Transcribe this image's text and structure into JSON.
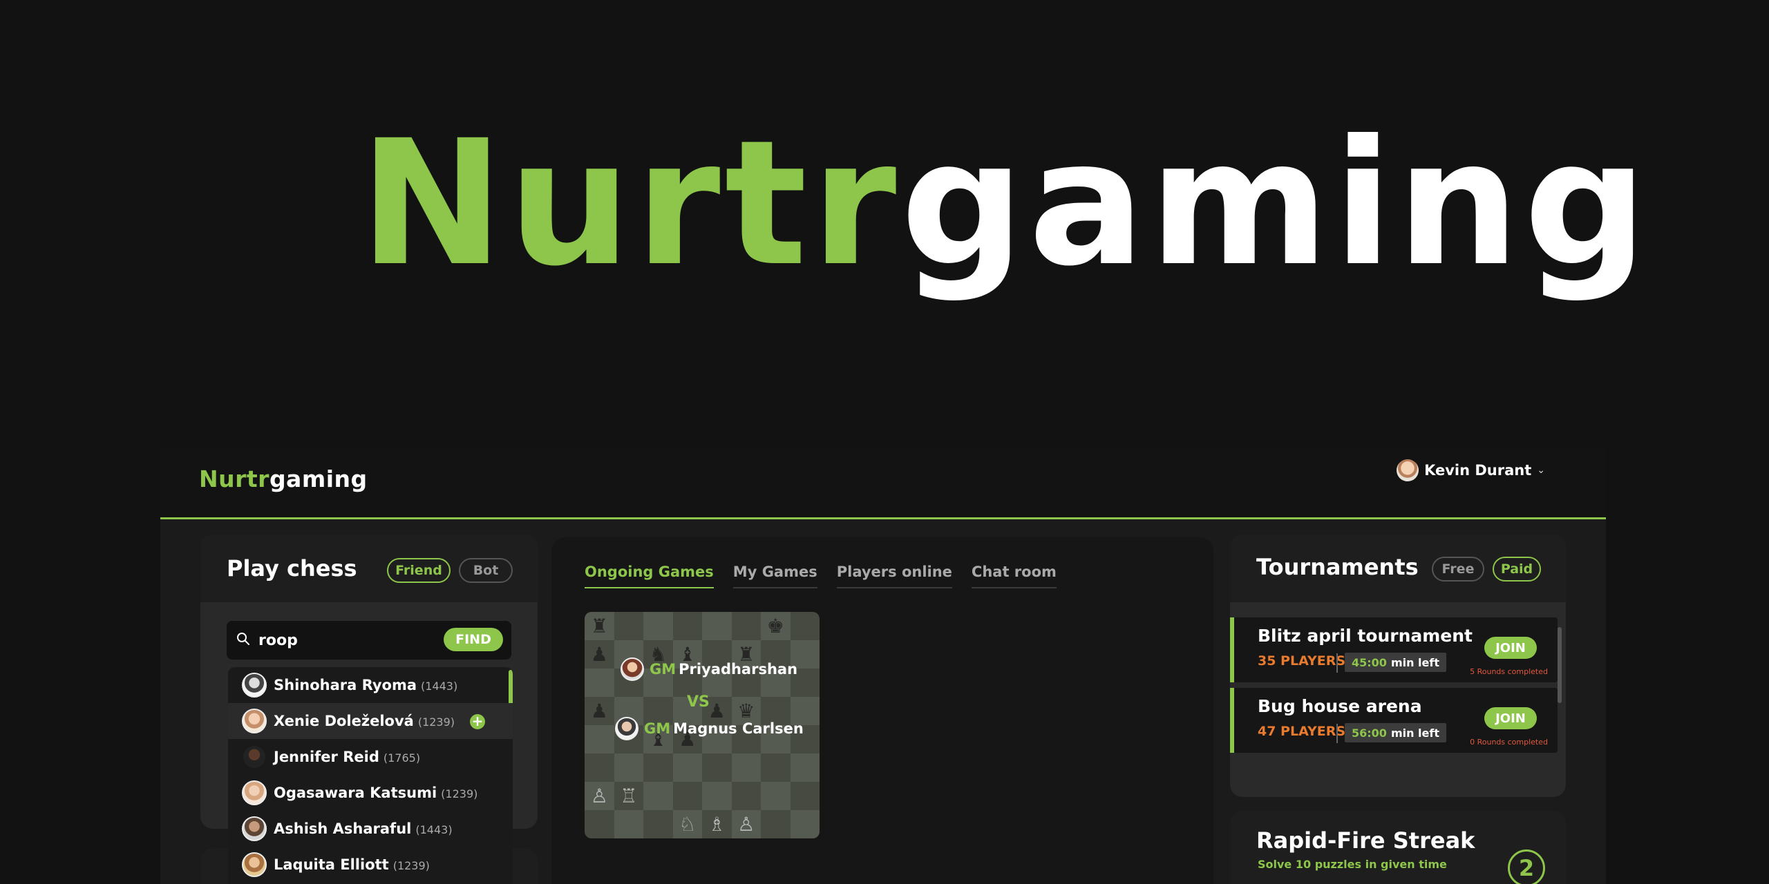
{
  "hero": {
    "brand_green": "Nurtr",
    "brand_white": "gaming"
  },
  "header": {
    "brand_green": "Nurtr",
    "brand_white": "gaming",
    "user_name": "Kevin Durant",
    "user_avatar_icon": "user-avatar"
  },
  "play": {
    "title": "Play chess",
    "filters": [
      {
        "label": "Friend",
        "active": true
      },
      {
        "label": "Bot",
        "active": false
      }
    ],
    "search": {
      "value": "roop",
      "find_label": "FIND"
    },
    "results": [
      {
        "name": "Shinohara Ryoma",
        "rating": "(1443)"
      },
      {
        "name": "Xenie Doleželová",
        "rating": "(1239)"
      },
      {
        "name": "Jennifer Reid",
        "rating": "(1765)"
      },
      {
        "name": "Ogasawara Katsumi",
        "rating": "(1239)"
      },
      {
        "name": "Ashish Asharaful",
        "rating": "(1443)"
      },
      {
        "name": "Laquita Elliott",
        "rating": "(1239)"
      }
    ]
  },
  "games": {
    "tabs": [
      {
        "label": "Ongoing Games",
        "active": true
      },
      {
        "label": "My Games",
        "active": false
      },
      {
        "label": "Players online",
        "active": false
      },
      {
        "label": "Chat room",
        "active": false
      }
    ],
    "match": {
      "player1": {
        "title": "GM",
        "name": "Priyadharshan"
      },
      "vs": "VS",
      "player2": {
        "title": "GM",
        "name": "Magnus Carlsen"
      }
    }
  },
  "tournaments": {
    "title": "Tournaments",
    "filters": [
      {
        "label": "Free",
        "active": false
      },
      {
        "label": "Paid",
        "active": true
      }
    ],
    "items": [
      {
        "name": "Blitz april tournament",
        "players": "35 PLAYERS",
        "time": "45:00",
        "time_suffix": "min left",
        "join": "JOIN",
        "rounds": "5 Rounds completed"
      },
      {
        "name": "Bug house arena",
        "players": "47 PLAYERS",
        "time": "56:00",
        "time_suffix": "min left",
        "join": "JOIN",
        "rounds": "0 Rounds completed"
      }
    ]
  },
  "rapid": {
    "title": "Rapid-Fire Streak",
    "subtitle": "Solve 10 puzzles in given time",
    "count": "2"
  },
  "colors": {
    "accent": "#8dc64a",
    "orange": "#e87b2e",
    "red": "#e0583e",
    "background": "#121212"
  },
  "icons": {
    "search": "search-icon",
    "add": "plus-icon",
    "chevron": "chevron-down-icon"
  }
}
